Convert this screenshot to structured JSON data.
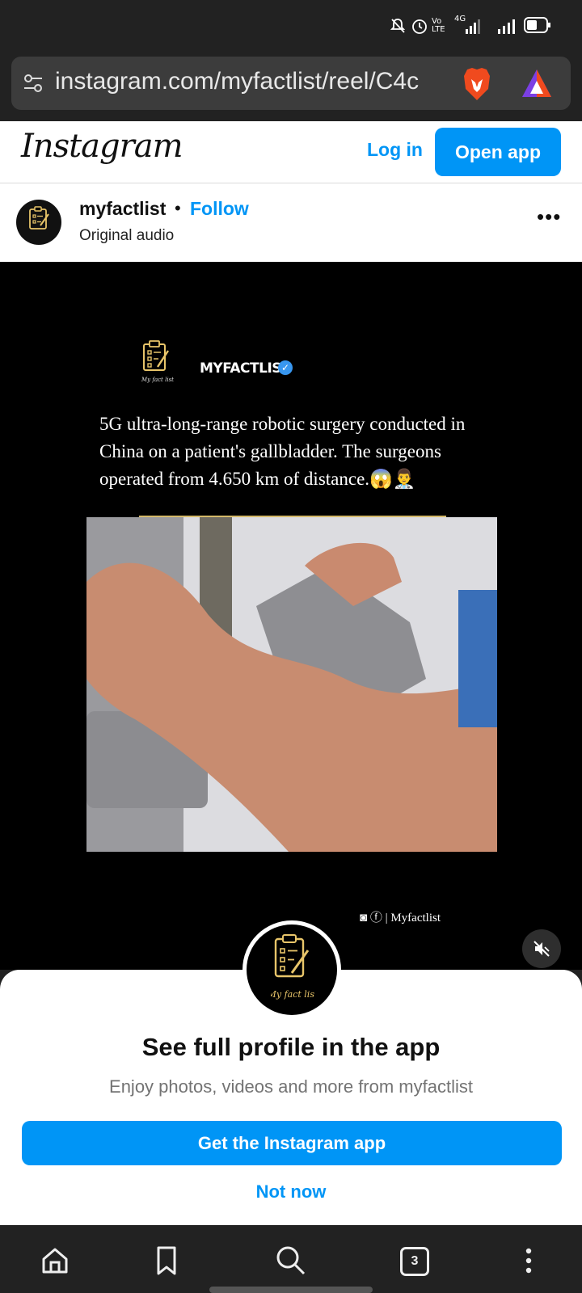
{
  "status_bar": {
    "network_label": "4G",
    "volte_label": "Vo LTE",
    "icons": [
      "mute-icon",
      "alarm-icon",
      "volte-icon",
      "signal-4g-icon",
      "signal-icon",
      "battery-icon"
    ]
  },
  "browser": {
    "url": "instagram.com/myfactlist/reel/C4c",
    "icons": [
      "site-settings-icon",
      "brave-lion-icon",
      "brave-rewards-icon"
    ]
  },
  "instagram": {
    "logo_text": "Instagram",
    "login_label": "Log in",
    "open_app_label": "Open app"
  },
  "post": {
    "username": "myfactlist",
    "separator": "•",
    "follow_label": "Follow",
    "audio": "Original audio",
    "more_label": "•••"
  },
  "reel": {
    "brand_name": "MYFACTLIST",
    "brand_script": "My fact list",
    "caption": "5G ultra-long-range robotic surgery conducted in China on a patient's gallbladder. The surgeons operated from 4.650 km of distance.😱👨‍⚕️",
    "social_handle": "Myfactlist"
  },
  "sheet": {
    "avatar_script": "My fact list",
    "title": "See full profile in the app",
    "subtitle": "Enjoy photos, videos and more from myfactlist",
    "get_app_label": "Get the Instagram app",
    "not_now_label": "Not now"
  },
  "bottom_nav": {
    "tab_count": "3",
    "icons": [
      "home-icon",
      "bookmark-icon",
      "search-icon",
      "tabs-icon",
      "menu-icon"
    ]
  },
  "colors": {
    "instagram_blue": "#0095f6",
    "brand_gold": "#e8c56a",
    "brave_orange": "#f04a1e"
  }
}
